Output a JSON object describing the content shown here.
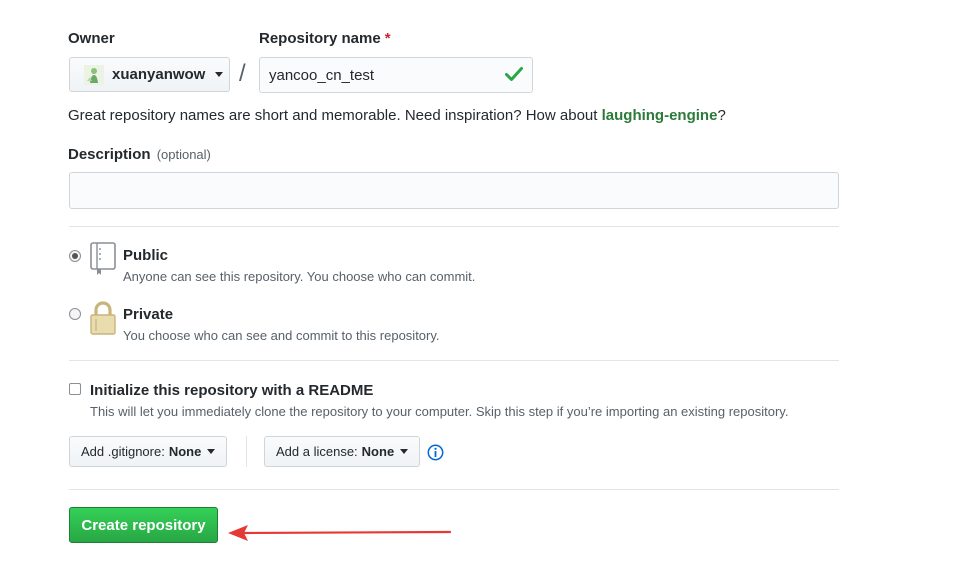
{
  "owner": {
    "label": "Owner",
    "username": "xuanyanwow"
  },
  "repo": {
    "label": "Repository name",
    "required_marker": "*",
    "value": "yancoo_cn_test"
  },
  "separator": "/",
  "hint": {
    "text": "Great repository names are short and memorable. Need inspiration? How about ",
    "suggestion": "laughing-engine",
    "suffix": "?"
  },
  "description": {
    "label": "Description",
    "optional": "(optional)",
    "value": ""
  },
  "visibility": {
    "selected": "public",
    "public": {
      "title": "Public",
      "note": "Anyone can see this repository. You choose who can commit."
    },
    "private": {
      "title": "Private",
      "note": "You choose who can see and commit to this repository."
    }
  },
  "readme": {
    "checked": false,
    "title": "Initialize this repository with a README",
    "note": "This will let you immediately clone the repository to your computer. Skip this step if you’re importing an existing repository."
  },
  "gitignore": {
    "label": "Add .gitignore:",
    "value": "None"
  },
  "license": {
    "label": "Add a license:",
    "value": "None"
  },
  "create_button": "Create repository",
  "colors": {
    "primary_green": "#28a745",
    "suggestion_green": "#2c7a3a",
    "annotation_arrow": "#e53935",
    "info_blue": "#0366d6",
    "required_red": "#cb2431"
  }
}
